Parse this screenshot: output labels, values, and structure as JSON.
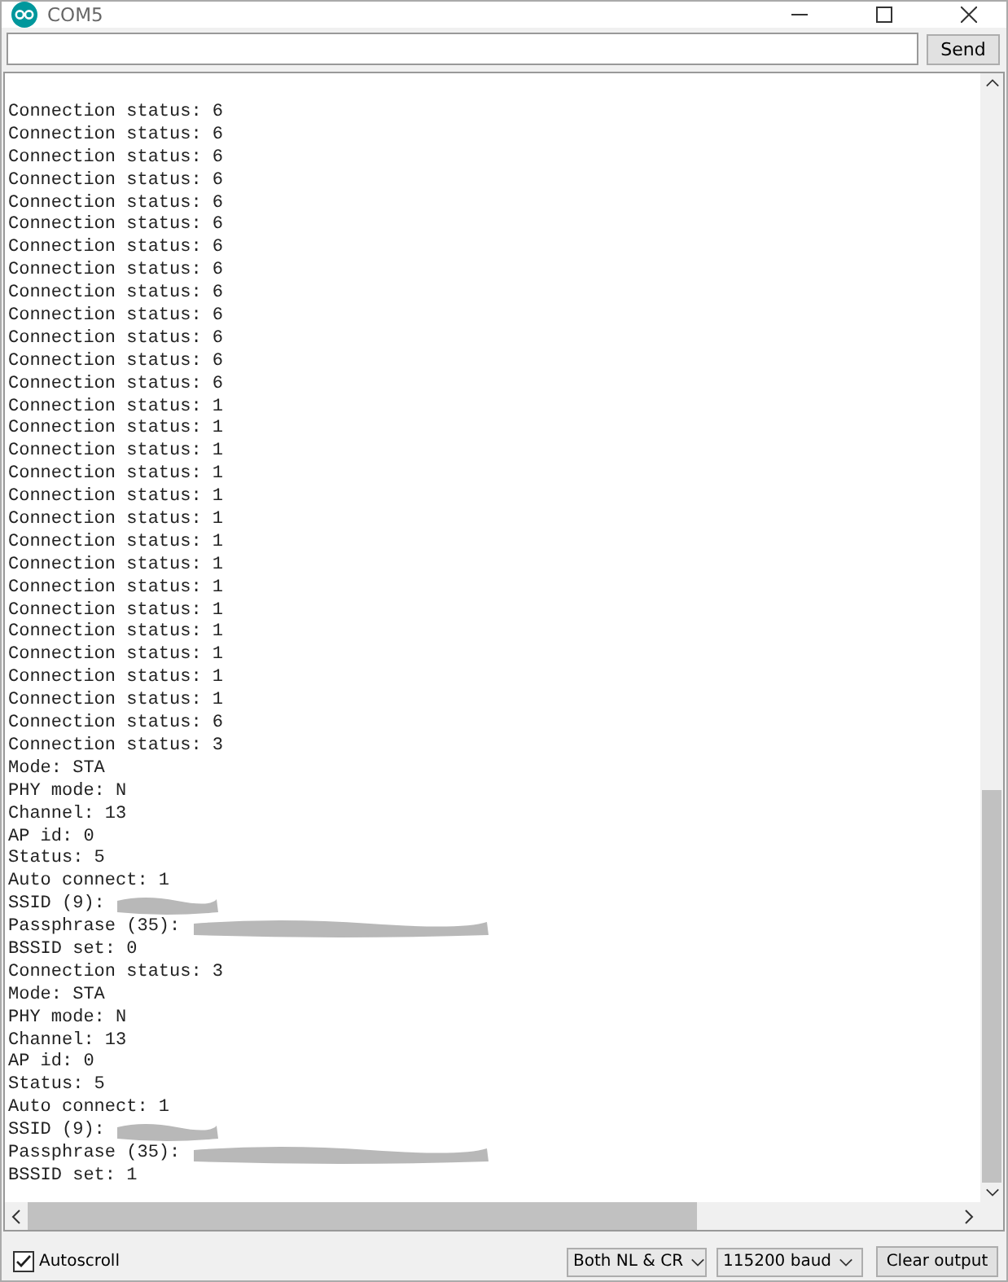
{
  "window": {
    "title": "COM5"
  },
  "send_button": "Send",
  "output_lines": [
    {
      "text": "Connection status: 6"
    },
    {
      "text": "Connection status: 6"
    },
    {
      "text": "Connection status: 6"
    },
    {
      "text": "Connection status: 6"
    },
    {
      "text": "Connection status: 6"
    },
    {
      "text": "Connection status: 6"
    },
    {
      "text": "Connection status: 6"
    },
    {
      "text": "Connection status: 6"
    },
    {
      "text": "Connection status: 6"
    },
    {
      "text": "Connection status: 6"
    },
    {
      "text": "Connection status: 6"
    },
    {
      "text": "Connection status: 6"
    },
    {
      "text": "Connection status: 6"
    },
    {
      "text": "Connection status: 1"
    },
    {
      "text": "Connection status: 1"
    },
    {
      "text": "Connection status: 1"
    },
    {
      "text": "Connection status: 1"
    },
    {
      "text": "Connection status: 1"
    },
    {
      "text": "Connection status: 1"
    },
    {
      "text": "Connection status: 1"
    },
    {
      "text": "Connection status: 1"
    },
    {
      "text": "Connection status: 1"
    },
    {
      "text": "Connection status: 1"
    },
    {
      "text": "Connection status: 1"
    },
    {
      "text": "Connection status: 1"
    },
    {
      "text": "Connection status: 1"
    },
    {
      "text": "Connection status: 1"
    },
    {
      "text": "Connection status: 6"
    },
    {
      "text": "Connection status: 3"
    },
    {
      "text": "Mode: STA"
    },
    {
      "text": "PHY mode: N"
    },
    {
      "text": "Channel: 13"
    },
    {
      "text": "AP id: 0"
    },
    {
      "text": "Status: 5"
    },
    {
      "text": "Auto connect: 1"
    },
    {
      "text": "SSID (9):",
      "redacted": true
    },
    {
      "text": "Passphrase (35):",
      "redacted": true
    },
    {
      "text": "BSSID set: 0"
    },
    {
      "text": "Connection status: 3"
    },
    {
      "text": "Mode: STA"
    },
    {
      "text": "PHY mode: N"
    },
    {
      "text": "Channel: 13"
    },
    {
      "text": "AP id: 0"
    },
    {
      "text": "Status: 5"
    },
    {
      "text": "Auto connect: 1"
    },
    {
      "text": "SSID (9):",
      "redacted": true
    },
    {
      "text": "Passphrase (35):",
      "redacted": true
    },
    {
      "text": "BSSID set: 1"
    }
  ],
  "autoscroll": {
    "label": "Autoscroll",
    "checked": true
  },
  "line_ending": "Both NL & CR",
  "baud_rate": "115200 baud",
  "clear_button": "Clear output"
}
